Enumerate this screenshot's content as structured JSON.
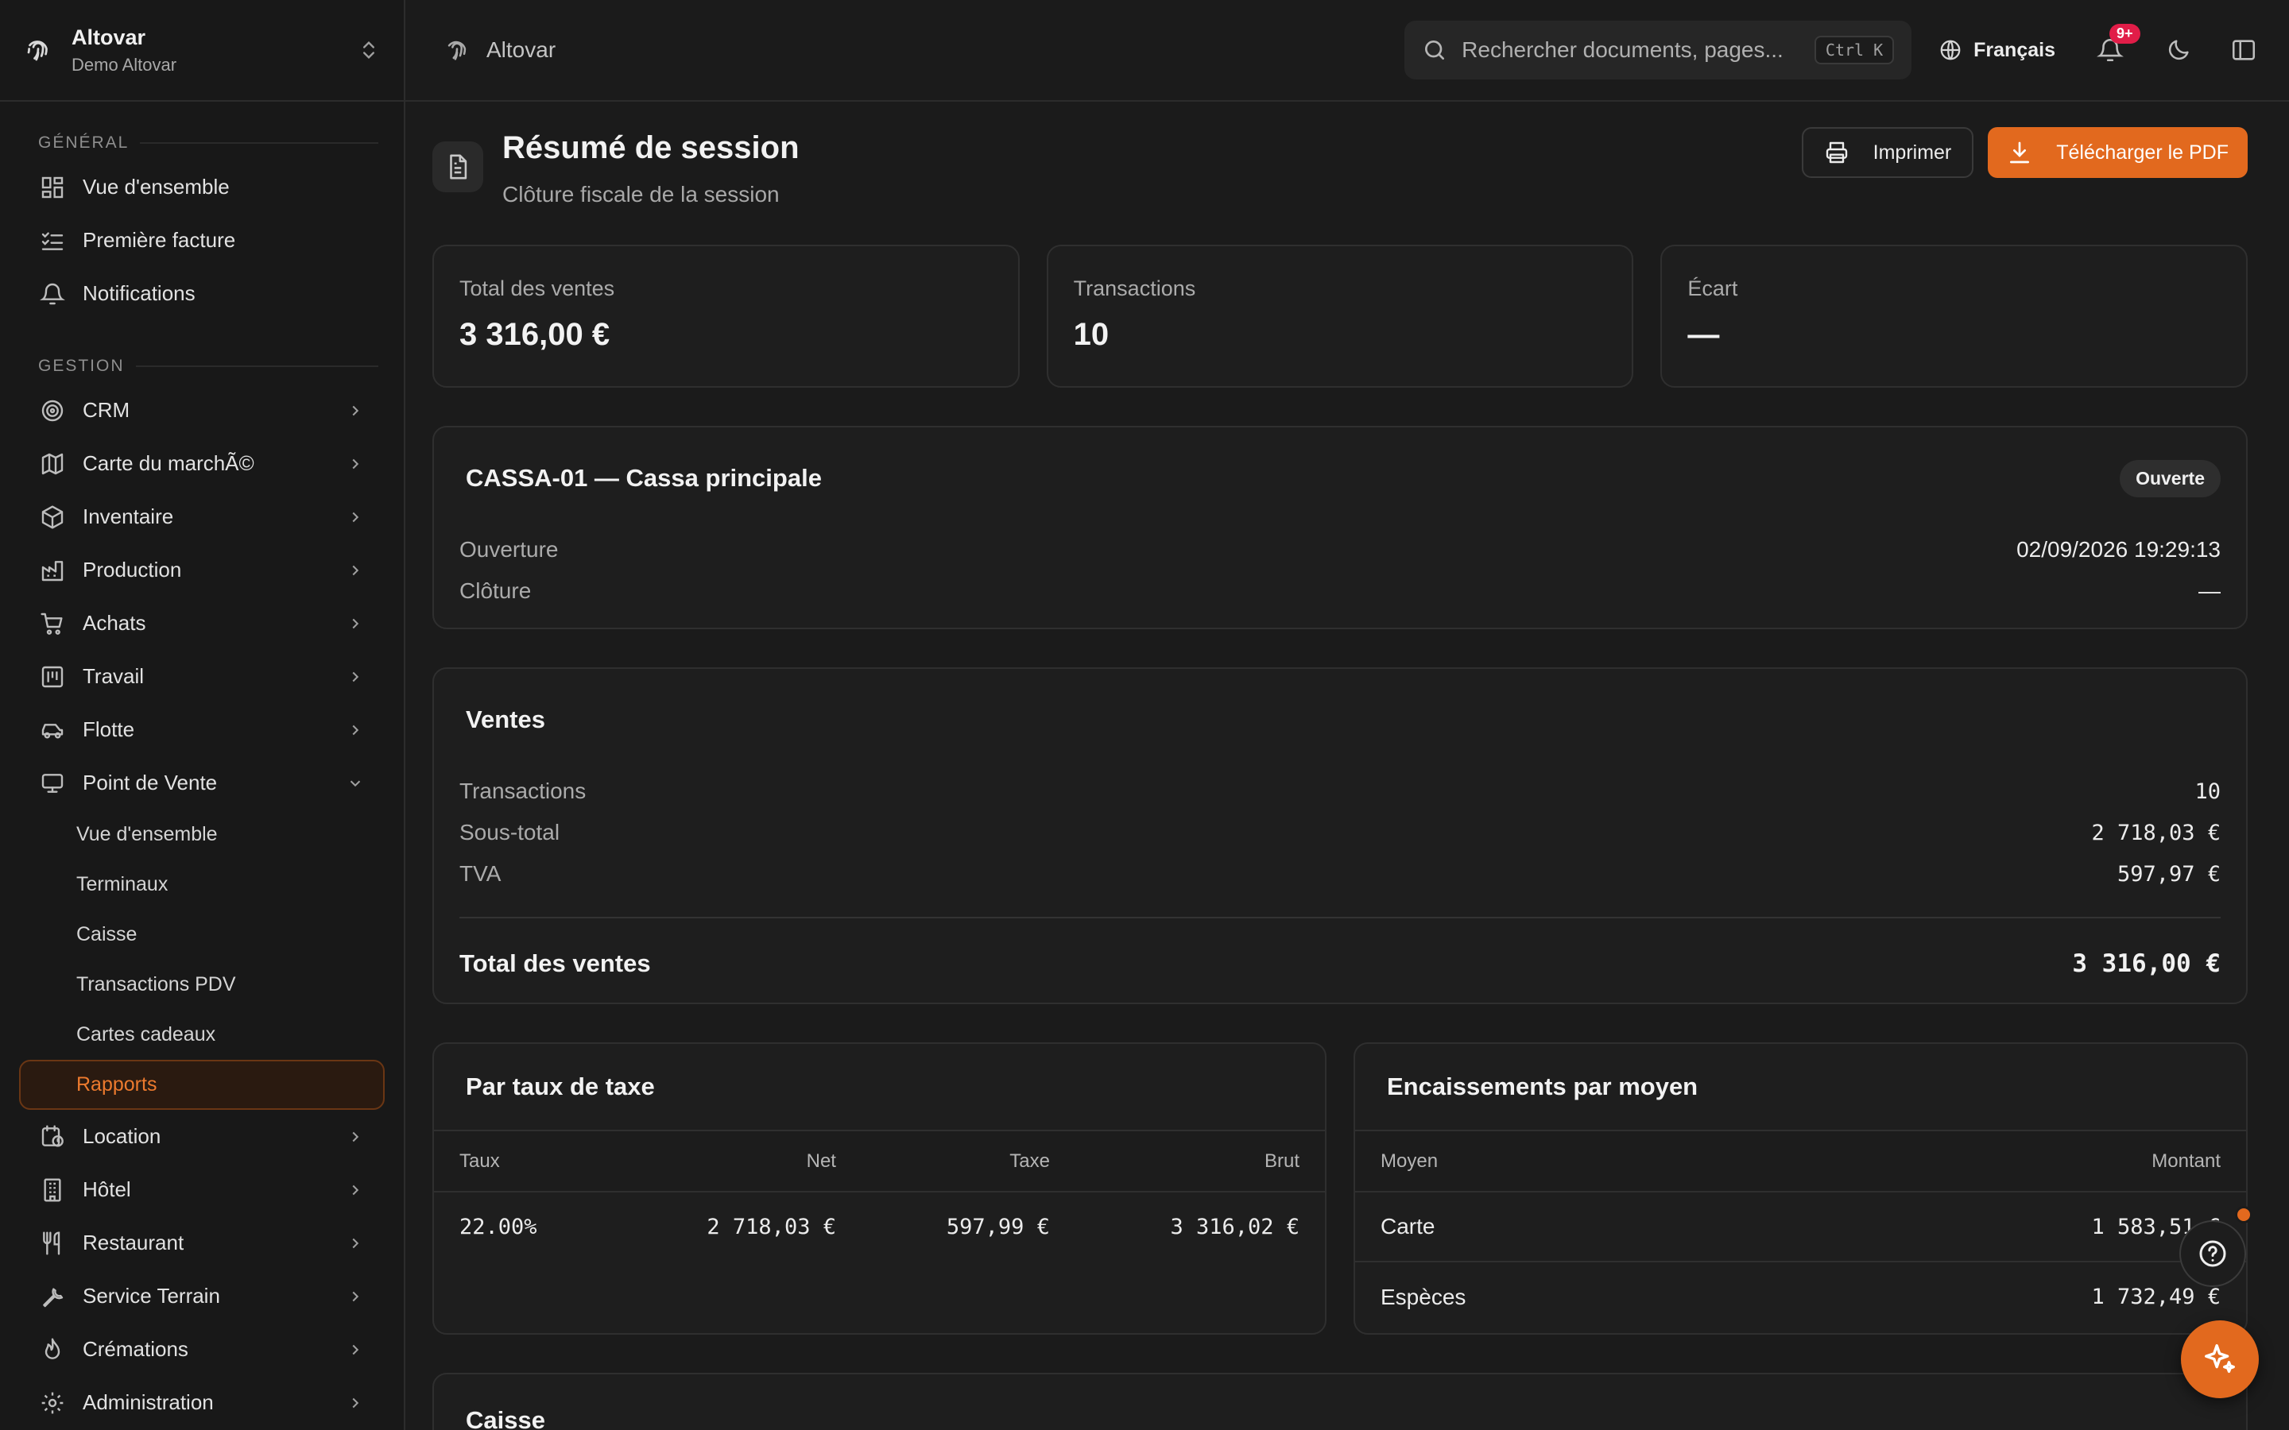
{
  "brand": {
    "org": "Altovar",
    "workspace": "Demo Altovar"
  },
  "sidebar": {
    "section_general": "GÉNÉRAL",
    "general_items": [
      {
        "label": "Vue d'ensemble",
        "icon": "dashboard-icon"
      },
      {
        "label": "Première facture",
        "icon": "checklist-icon"
      },
      {
        "label": "Notifications",
        "icon": "bell-icon"
      }
    ],
    "section_gestion": "GESTION",
    "gestion_items": [
      {
        "label": "CRM",
        "icon": "target-icon"
      },
      {
        "label": "Carte du marchÃ©",
        "icon": "map-icon"
      },
      {
        "label": "Inventaire",
        "icon": "package-icon"
      },
      {
        "label": "Production",
        "icon": "factory-icon"
      },
      {
        "label": "Achats",
        "icon": "cart-icon"
      },
      {
        "label": "Travail",
        "icon": "calendar-icon"
      },
      {
        "label": "Flotte",
        "icon": "car-icon"
      },
      {
        "label": "Point de Vente",
        "icon": "monitor-icon"
      }
    ],
    "pos_subitems": [
      "Vue d'ensemble",
      "Terminaux",
      "Caisse",
      "Transactions PDV",
      "Cartes cadeaux",
      "Rapports"
    ],
    "more_items": [
      {
        "label": "Location",
        "icon": "calendar-clock-icon"
      },
      {
        "label": "Hôtel",
        "icon": "building-icon"
      },
      {
        "label": "Restaurant",
        "icon": "utensils-icon"
      },
      {
        "label": "Service Terrain",
        "icon": "wrench-icon"
      },
      {
        "label": "Crémations",
        "icon": "flame-icon"
      },
      {
        "label": "Administration",
        "icon": "gear-icon"
      }
    ]
  },
  "topbar": {
    "breadcrumb": "Altovar",
    "search_placeholder": "Rechercher documents, pages...",
    "shortcut": "Ctrl K",
    "language": "Français",
    "notif_badge": "9+"
  },
  "page": {
    "title": "Résumé de session",
    "subtitle": "Clôture fiscale de la session",
    "print_label": "Imprimer",
    "download_label": "Télécharger le PDF"
  },
  "stats": [
    {
      "label": "Total des ventes",
      "value": "3 316,00 €"
    },
    {
      "label": "Transactions",
      "value": "10"
    },
    {
      "label": "Écart",
      "value": "—"
    }
  ],
  "session": {
    "title": "CASSA-01 — Cassa principale",
    "status": "Ouverte",
    "opening_label": "Ouverture",
    "opening_value": "02/09/2026 19:29:13",
    "closing_label": "Clôture",
    "closing_value": "—"
  },
  "ventes": {
    "title": "Ventes",
    "rows": [
      {
        "label": "Transactions",
        "value": "10"
      },
      {
        "label": "Sous-total",
        "value": "2 718,03 €"
      },
      {
        "label": "TVA",
        "value": "597,97 €"
      }
    ],
    "total_label": "Total des ventes",
    "total_value": "3 316,00 €"
  },
  "tax": {
    "title": "Par taux de taxe",
    "headers": [
      "Taux",
      "Net",
      "Taxe",
      "Brut"
    ],
    "rows": [
      [
        "22.00%",
        "2 718,03 €",
        "597,99 €",
        "3 316,02 €"
      ]
    ]
  },
  "payments": {
    "title": "Encaissements par moyen",
    "headers": [
      "Moyen",
      "Montant"
    ],
    "rows": [
      [
        "Carte",
        "1 583,51 €"
      ],
      [
        "Espèces",
        "1 732,49 €"
      ]
    ]
  },
  "caisse": {
    "title": "Caisse"
  },
  "colors": {
    "accent": "#e2691e",
    "badge": "#e11d48"
  }
}
